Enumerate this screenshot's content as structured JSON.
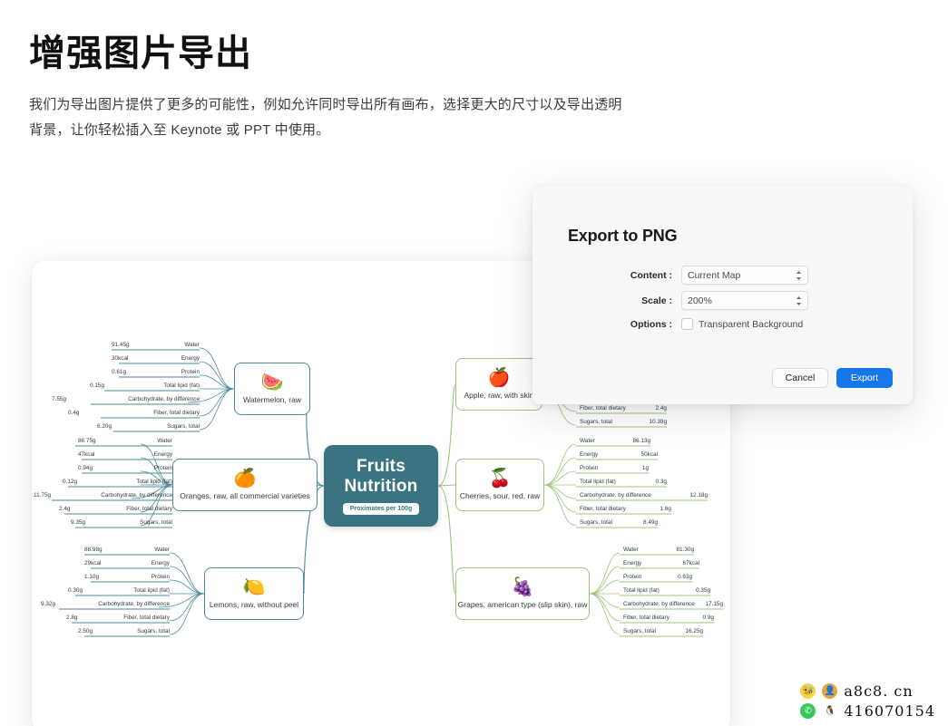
{
  "hero": {
    "title": "增强图片导出",
    "subtitle": "我们为导出图片提供了更多的可能性，例如允许同时导出所有画布，选择更大的尺寸以及导出透明背景，让你轻松插入至 Keynote 或 PPT 中使用。"
  },
  "dialog": {
    "title": "Export to PNG",
    "content_label": "Content :",
    "content_value": "Current Map",
    "scale_label": "Scale :",
    "scale_value": "200%",
    "options_label": "Options :",
    "transparent_label": "Transparent Background",
    "cancel_label": "Cancel",
    "export_label": "Export",
    "accent_color": "#1478e8"
  },
  "mindmap": {
    "center": {
      "title": "Fruits Nutrition",
      "badge": "Proximates per 100g",
      "color": "#3b7481"
    },
    "nodes": [
      {
        "id": "watermelon",
        "label": "Watermelon, raw",
        "emoji": "🍉",
        "side": "left",
        "branch_color": "#4a8b97",
        "attributes": [
          {
            "value": "91.45g",
            "key": "Water"
          },
          {
            "value": "30kcal",
            "key": "Energy"
          },
          {
            "value": "0.61g",
            "key": "Protein"
          },
          {
            "value": "0.15g",
            "key": "Total lipid (fat)"
          },
          {
            "value": "7.55g",
            "key": "Carbohydrate, by difference"
          },
          {
            "value": "0.4g",
            "key": "Fiber, total dietary"
          },
          {
            "value": "6.20g",
            "key": "Sugars, total"
          }
        ]
      },
      {
        "id": "oranges",
        "label": "Oranges, raw, all commercial varieties",
        "emoji": "🍊",
        "side": "left",
        "branch_color": "#4a8b97",
        "attributes": [
          {
            "value": "86.75g",
            "key": "Water"
          },
          {
            "value": "47kcal",
            "key": "Energy"
          },
          {
            "value": "0.94g",
            "key": "Protein"
          },
          {
            "value": "0.12g",
            "key": "Total lipid (fat)"
          },
          {
            "value": "11.75g",
            "key": "Carbohydrate, by difference"
          },
          {
            "value": "2.4g",
            "key": "Fiber, total dietary"
          },
          {
            "value": "9.35g",
            "key": "Sugars, total"
          }
        ]
      },
      {
        "id": "lemons",
        "label": "Lemons, raw, without peel",
        "emoji": "🍋",
        "side": "left",
        "branch_color": "#4a8b97",
        "attributes": [
          {
            "value": "88.98g",
            "key": "Water"
          },
          {
            "value": "29kcal",
            "key": "Energy"
          },
          {
            "value": "1.10g",
            "key": "Protein"
          },
          {
            "value": "0.30g",
            "key": "Total lipid (fat)"
          },
          {
            "value": "9.32g",
            "key": "Carbohydrate, by difference"
          },
          {
            "value": "2.8g",
            "key": "Fiber, total dietary"
          },
          {
            "value": "2.50g",
            "key": "Sugars, total"
          }
        ]
      },
      {
        "id": "apple",
        "label": "Apple, raw, with skin",
        "emoji": "🍎",
        "side": "right",
        "branch_color": "#9cc47d",
        "attributes": [
          {
            "key": "Fiber, total dietary",
            "value": "2.4g"
          },
          {
            "key": "Sugars, total",
            "value": "10.39g"
          }
        ]
      },
      {
        "id": "cherries",
        "label": "Cherries, sour, red, raw",
        "emoji": "🍒",
        "side": "right",
        "branch_color": "#9cc47d",
        "attributes": [
          {
            "key": "Water",
            "value": "86.13g"
          },
          {
            "key": "Energy",
            "value": "50kcal"
          },
          {
            "key": "Protein",
            "value": "1g"
          },
          {
            "key": "Total lipid (fat)",
            "value": "0.3g"
          },
          {
            "key": "Carbohydrate, by difference",
            "value": "12.18g"
          },
          {
            "key": "Fiber, total dietary",
            "value": "1.6g"
          },
          {
            "key": "Sugars, total",
            "value": "8.49g"
          }
        ]
      },
      {
        "id": "grapes",
        "label": "Grapes, american type (slip skin), raw",
        "emoji": "🍇",
        "side": "right",
        "branch_color": "#9cc47d",
        "attributes": [
          {
            "key": "Water",
            "value": "81.30g"
          },
          {
            "key": "Energy",
            "value": "67kcal"
          },
          {
            "key": "Protein",
            "value": "0.63g"
          },
          {
            "key": "Total lipid (fat)",
            "value": "0.35g"
          },
          {
            "key": "Carbohydrate, by difference",
            "value": "17.15g"
          },
          {
            "key": "Fiber, total dietary",
            "value": "0.9g"
          },
          {
            "key": "Sugars, total",
            "value": "16.25g"
          }
        ]
      }
    ]
  },
  "watermark": {
    "site": "a8c8. cn",
    "qq": "416070154"
  }
}
